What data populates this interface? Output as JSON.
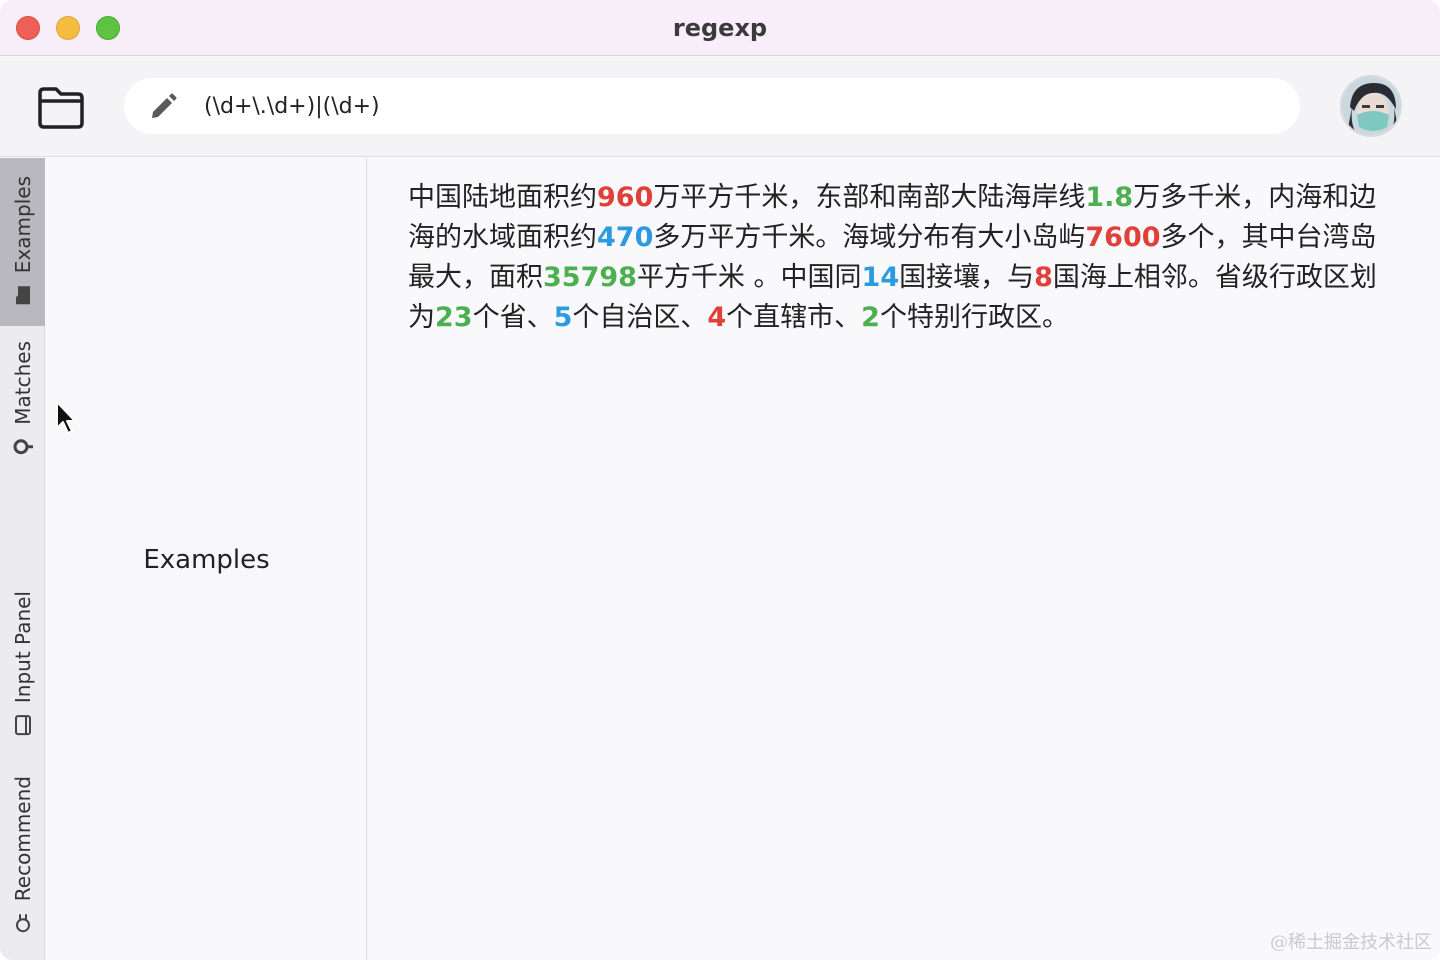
{
  "window": {
    "title": "regexp"
  },
  "toolbar": {
    "regex_value": "(\\d+\\.\\d+)|(\\d+)"
  },
  "rail": {
    "tabs": [
      {
        "label": "Examples",
        "icon": "folder-icon",
        "active": true
      },
      {
        "label": "Matches",
        "icon": "match-icon",
        "active": false
      },
      {
        "label": "Input Panel",
        "icon": "panel-icon",
        "active": false
      },
      {
        "label": "Recommend",
        "icon": "lightbulb-icon",
        "active": false
      }
    ]
  },
  "side_panel": {
    "label": "Examples"
  },
  "match_colors": {
    "red": "#e0403a",
    "green": "#4caf50",
    "blue": "#2b9ae0"
  },
  "content": {
    "segments": [
      {
        "text": "中国陆地面积约"
      },
      {
        "text": "960",
        "color": "red"
      },
      {
        "text": "万平方千米，东部和南部大陆海岸线"
      },
      {
        "text": "1.8",
        "color": "green"
      },
      {
        "text": "万多千米，内海和边海的水域面积约"
      },
      {
        "text": "470",
        "color": "blue"
      },
      {
        "text": "多万平方千米。海域分布有大小岛屿"
      },
      {
        "text": "7600",
        "color": "red"
      },
      {
        "text": "多个，其中台湾岛最大，面积"
      },
      {
        "text": "35798",
        "color": "green"
      },
      {
        "text": "平方千米 。中国同"
      },
      {
        "text": "14",
        "color": "blue"
      },
      {
        "text": "国接壤，与"
      },
      {
        "text": "8",
        "color": "red"
      },
      {
        "text": "国海上相邻。省级行政区划为"
      },
      {
        "text": "23",
        "color": "green"
      },
      {
        "text": "个省、"
      },
      {
        "text": "5",
        "color": "blue"
      },
      {
        "text": "个自治区、"
      },
      {
        "text": "4",
        "color": "red"
      },
      {
        "text": "个直辖市、"
      },
      {
        "text": "2",
        "color": "green"
      },
      {
        "text": "个特别行政区。"
      }
    ]
  },
  "watermark": "@稀土掘金技术社区"
}
